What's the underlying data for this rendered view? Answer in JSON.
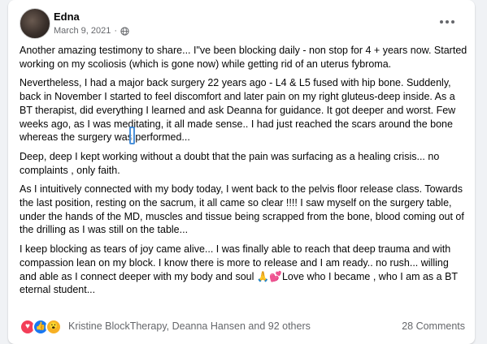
{
  "post": {
    "author": "Edna",
    "date": "March 9, 2021",
    "privacy_icon": "globe-icon",
    "more_icon": "more-options-icon",
    "paragraphs": [
      "Another amazing testimony to share... I\"ve been blocking daily - non stop for 4 + years now.   Started working on my scoliosis (which is gone now) while getting rid of an uterus fybroma.",
      "Nevertheless, I had a major back surgery 22 years ago - L4 & L5 fused with hip bone. Suddenly, back in November I started to feel discomfort and later pain on my right gluteus-deep inside.  As a BT therapist, did everything I learned and ask Deanna for guidance.   It got deeper and worst.  Few weeks ago, as I was meditating, it all made sense.. I had just reached the scars around the bone whereas the surgery was performed...",
      "Deep, deep I kept working without a doubt that the pain was surfacing as a healing crisis... no complaints , only faith.",
      "As I intuitively connected with my body today, I went back to the pelvis floor release class. Towards the last position, resting on the sacrum, it all came so clear !!!!  I saw myself on the surgery table, under the hands of the MD, muscles and tissue being scrapped from the bone, blood coming out of the drilling as I was still on the table...",
      "I keep blocking as tears of joy came alive... I was finally able to reach that deep trauma and with compassion lean on my block.  I know there is more to release and I am ready.. no rush... willing and able as I connect deeper with my body and soul 🙏💕Love who I became , who I am as a BT eternal student..."
    ]
  },
  "footer": {
    "reactions": [
      "love",
      "like",
      "wow"
    ],
    "reactors_text": "Kristine BlockTherapy, Deanna Hansen and 92 others",
    "comments_text": "28 Comments"
  },
  "colors": {
    "love": "#f33e58",
    "like": "#1877f2",
    "wow": "#f7b125"
  }
}
